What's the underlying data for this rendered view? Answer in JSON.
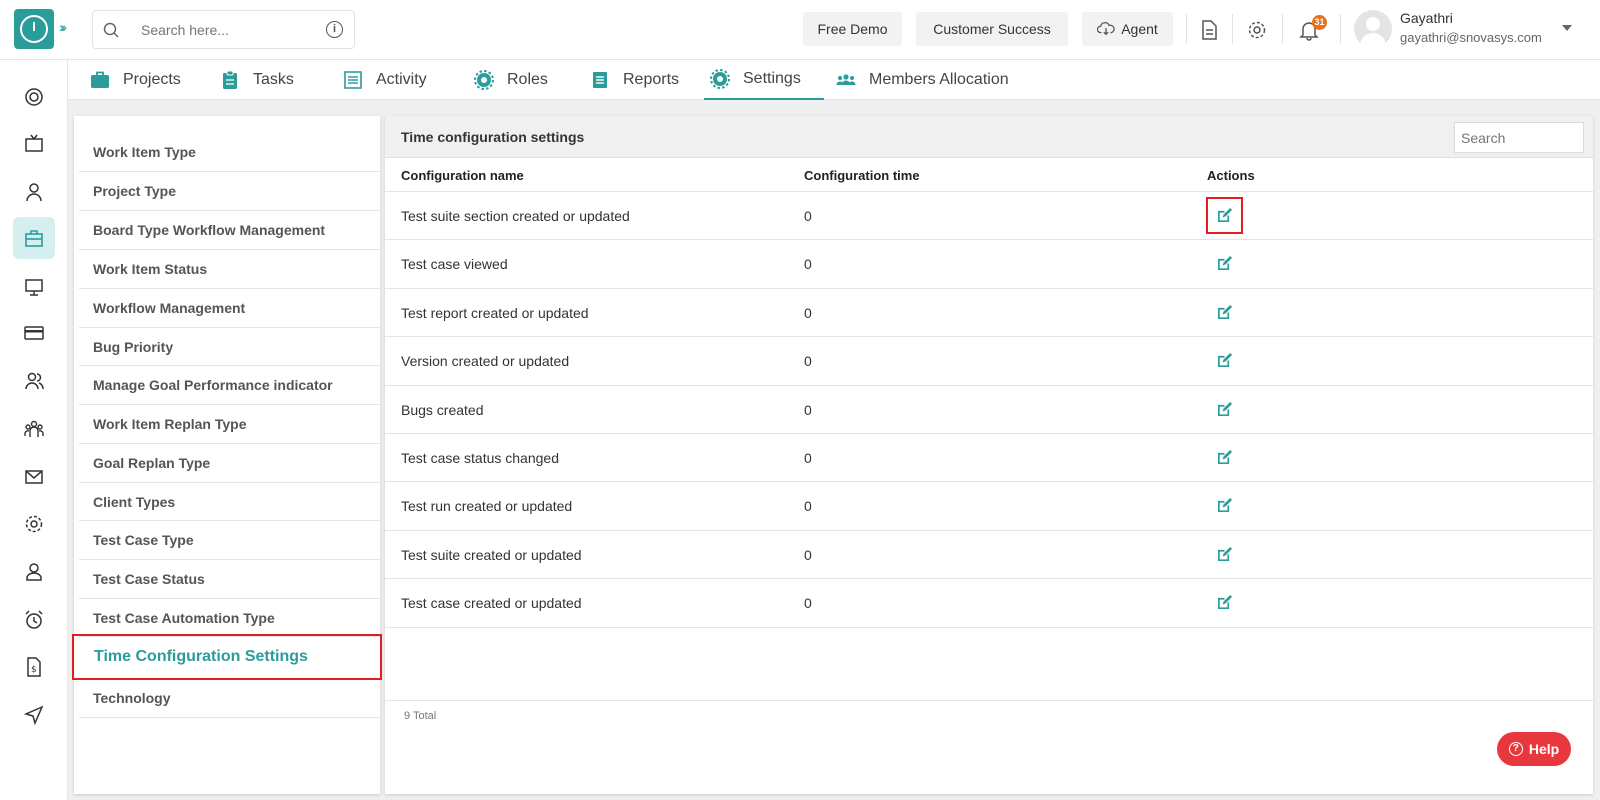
{
  "header": {
    "search_placeholder": "Search here...",
    "free_demo": "Free Demo",
    "customer_success": "Customer Success",
    "agent": "Agent",
    "notification_count": "31",
    "user_name": "Gayathri",
    "user_email": "gayathri@snovasys.com"
  },
  "tabs": [
    {
      "label": "Projects",
      "icon": "briefcase-icon"
    },
    {
      "label": "Tasks",
      "icon": "clipboard-icon"
    },
    {
      "label": "Activity",
      "icon": "list-icon"
    },
    {
      "label": "Roles",
      "icon": "gear-icon"
    },
    {
      "label": "Reports",
      "icon": "document-icon"
    },
    {
      "label": "Settings",
      "icon": "gear-icon",
      "active": true
    },
    {
      "label": "Members Allocation",
      "icon": "people-icon"
    }
  ],
  "left_menu": [
    "Work Item Type",
    "Project Type",
    "Board Type Workflow Management",
    "Work Item Status",
    "Workflow Management",
    "Bug Priority",
    "Manage Goal Performance indicator",
    "Work Item Replan Type",
    "Goal Replan Type",
    "Client Types",
    "Test Case Type",
    "Test Case Status",
    "Test Case Automation Type",
    "Time Configuration Settings",
    "Technology"
  ],
  "left_menu_selected": "Time Configuration Settings",
  "panel": {
    "title": "Time configuration settings",
    "search_placeholder": "Search",
    "columns": [
      "Configuration name",
      "Configuration time",
      "Actions"
    ],
    "rows": [
      {
        "name": "Test suite section created or updated",
        "time": "0"
      },
      {
        "name": "Test case viewed",
        "time": "0"
      },
      {
        "name": "Test report created or updated",
        "time": "0"
      },
      {
        "name": "Version created or updated",
        "time": "0"
      },
      {
        "name": "Bugs created",
        "time": "0"
      },
      {
        "name": "Test case status changed",
        "time": "0"
      },
      {
        "name": "Test run created or updated",
        "time": "0"
      },
      {
        "name": "Test suite created or updated",
        "time": "0"
      },
      {
        "name": "Test case created or updated",
        "time": "0"
      }
    ],
    "total": "9 Total"
  },
  "help_label": "Help",
  "colors": {
    "accent": "#2a9d9b",
    "highlight": "#e02020",
    "help": "#e8383d",
    "badge": "#e8731c"
  }
}
